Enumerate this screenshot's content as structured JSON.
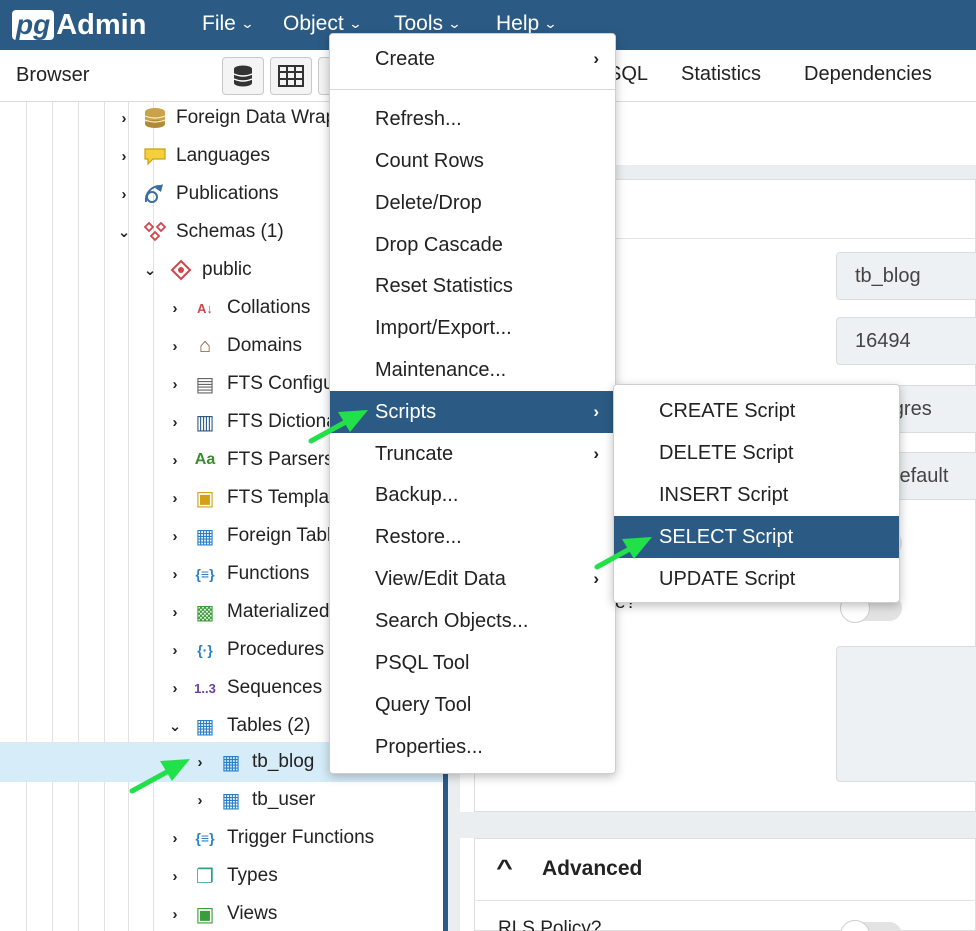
{
  "app": {
    "logo_pg": "pg",
    "logo_admin": "Admin"
  },
  "navbar": {
    "menus": [
      {
        "label": "File"
      },
      {
        "label": "Object"
      },
      {
        "label": "Tools"
      },
      {
        "label": "Help"
      }
    ],
    "chevron": "⌄"
  },
  "browser": {
    "title": "Browser"
  },
  "tabs": [
    {
      "label": "SQL"
    },
    {
      "label": "Statistics"
    },
    {
      "label": "Dependencies"
    }
  ],
  "tree": {
    "items": [
      {
        "label": "Foreign Data Wrappers",
        "icon": "foreign-data-wrapper-icon",
        "toggle": "›"
      },
      {
        "label": "Languages",
        "icon": "languages-icon",
        "toggle": "›"
      },
      {
        "label": "Publications",
        "icon": "publications-icon",
        "toggle": "›"
      },
      {
        "label": "Schemas (1)",
        "icon": "schemas-icon",
        "toggle": "⌄"
      },
      {
        "label": "public",
        "icon": "schema-icon",
        "toggle": "⌄"
      },
      {
        "label": "Collations",
        "icon": "collations-icon",
        "toggle": "›",
        "glyph": "A↓"
      },
      {
        "label": "Domains",
        "icon": "domains-icon",
        "toggle": "›",
        "glyph": "⌂"
      },
      {
        "label": "FTS Configurations",
        "icon": "fts-config-icon",
        "toggle": "›",
        "glyph": "▤"
      },
      {
        "label": "FTS Dictionaries",
        "icon": "fts-dictionary-icon",
        "toggle": "›",
        "glyph": "▥"
      },
      {
        "label": "FTS Parsers",
        "icon": "fts-parser-icon",
        "toggle": "›",
        "glyph": "Aa"
      },
      {
        "label": "FTS Templates",
        "icon": "fts-template-icon",
        "toggle": "›",
        "glyph": "▣"
      },
      {
        "label": "Foreign Tables",
        "icon": "foreign-table-icon",
        "toggle": "›",
        "glyph": "▦"
      },
      {
        "label": "Functions",
        "icon": "functions-icon",
        "toggle": "›",
        "glyph": "{≡}"
      },
      {
        "label": "Materialized Views",
        "icon": "materialized-view-icon",
        "toggle": "›",
        "glyph": "▩"
      },
      {
        "label": "Procedures",
        "icon": "procedures-icon",
        "toggle": "›",
        "glyph": "{·}"
      },
      {
        "label": "Sequences",
        "icon": "sequences-icon",
        "toggle": "›",
        "glyph": "1..3"
      },
      {
        "label": "Tables (2)",
        "icon": "tables-icon",
        "toggle": "⌄",
        "glyph": "▦"
      },
      {
        "label": "tb_blog",
        "icon": "table-icon",
        "toggle": "›",
        "glyph": "▦"
      },
      {
        "label": "tb_user",
        "icon": "table-icon",
        "toggle": "›",
        "glyph": "▦"
      },
      {
        "label": "Trigger Functions",
        "icon": "trigger-function-icon",
        "toggle": "›",
        "glyph": "{≡}"
      },
      {
        "label": "Types",
        "icon": "types-icon",
        "toggle": "›",
        "glyph": "❐"
      },
      {
        "label": "Views",
        "icon": "views-icon",
        "toggle": "›",
        "glyph": "▣"
      }
    ]
  },
  "properties": {
    "name_value": "tb_blog",
    "oid_value": "16494",
    "owner_value": "postgres",
    "tablespace_value": "pg_default",
    "advanced_label": "Advanced",
    "rls_label": "RLS Policy?",
    "partial_label": "e?"
  },
  "context_menu": {
    "items": [
      {
        "label": "Create",
        "submenu": true
      },
      {
        "label": "Refresh..."
      },
      {
        "label": "Count Rows"
      },
      {
        "label": "Delete/Drop"
      },
      {
        "label": "Drop Cascade"
      },
      {
        "label": "Reset Statistics"
      },
      {
        "label": "Import/Export..."
      },
      {
        "label": "Maintenance..."
      },
      {
        "label": "Scripts",
        "submenu": true,
        "highlighted": true
      },
      {
        "label": "Truncate",
        "submenu": true
      },
      {
        "label": "Backup..."
      },
      {
        "label": "Restore..."
      },
      {
        "label": "View/Edit Data",
        "submenu": true
      },
      {
        "label": "Search Objects..."
      },
      {
        "label": "PSQL Tool"
      },
      {
        "label": "Query Tool"
      },
      {
        "label": "Properties..."
      }
    ],
    "arrow": "›"
  },
  "scripts_submenu": {
    "items": [
      {
        "label": "CREATE Script"
      },
      {
        "label": "DELETE Script"
      },
      {
        "label": "INSERT Script"
      },
      {
        "label": "SELECT Script",
        "highlighted": true
      },
      {
        "label": "UPDATE Script"
      }
    ]
  },
  "colors": {
    "brand": "#2b5b84",
    "selected_row": "#d6ecf8",
    "annotation_arrow": "#22e04a"
  }
}
